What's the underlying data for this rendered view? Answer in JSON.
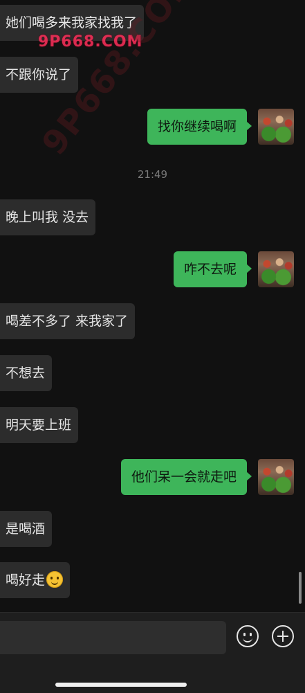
{
  "watermark": {
    "top": "9P668.COM",
    "diagonal": "9P668.COM"
  },
  "messages": [
    {
      "side": "in",
      "text": "她们喝多来我家找我了"
    },
    {
      "side": "in",
      "text": "不跟你说了"
    },
    {
      "side": "out",
      "text": "找你继续喝啊"
    },
    {
      "side": "time",
      "text": "21:49"
    },
    {
      "side": "in",
      "text": "晚上叫我 没去"
    },
    {
      "side": "out",
      "text": "咋不去呢"
    },
    {
      "side": "in",
      "text": "喝差不多了 来我家了"
    },
    {
      "side": "in",
      "text": "不想去"
    },
    {
      "side": "in",
      "text": "明天要上班"
    },
    {
      "side": "out",
      "text": "他们呆一会就走吧"
    },
    {
      "side": "in",
      "text": "是喝酒"
    },
    {
      "side": "in",
      "text": "喝好走",
      "emoji": "smile-emoji"
    }
  ],
  "input": {
    "placeholder": ""
  },
  "icons": {
    "emoji_button": "smiley-icon",
    "plus_button": "plus-circle-icon"
  },
  "colors": {
    "outgoing_bubble": "#3eb55a",
    "incoming_bubble": "#2c2c2c",
    "background": "#111111"
  }
}
